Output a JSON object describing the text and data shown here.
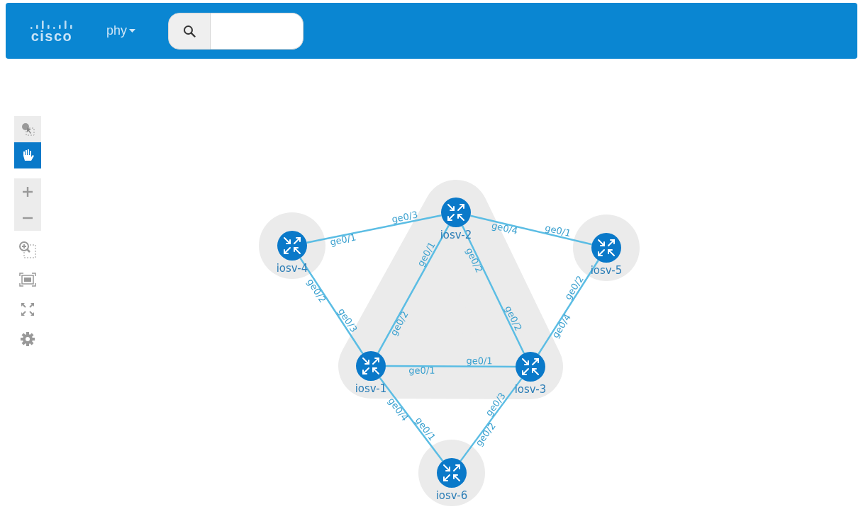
{
  "header": {
    "logo": "cisco",
    "view_menu": "phy"
  },
  "toolbar": {
    "mode_tools": [
      {
        "selected": false
      },
      {
        "selected": true
      }
    ]
  },
  "topology": {
    "nodes": [
      {
        "name": "iosv-2"
      },
      {
        "name": "iosv-4"
      },
      {
        "name": "iosv-5"
      },
      {
        "name": "iosv-1"
      },
      {
        "name": "iosv-3"
      },
      {
        "name": "iosv-6"
      }
    ],
    "links": [
      {
        "ends": [
          {
            "interface": "ge0/1"
          },
          {
            "interface": "ge0/3"
          }
        ]
      },
      {
        "ends": [
          {
            "interface": "ge0/4"
          },
          {
            "interface": "ge0/1"
          }
        ]
      },
      {
        "ends": [
          {
            "interface": "ge0/1"
          },
          {
            "interface": "ge0/2"
          }
        ]
      },
      {
        "ends": [
          {
            "interface": "ge0/2"
          },
          {
            "interface": "ge0/2"
          }
        ]
      },
      {
        "ends": [
          {
            "interface": "ge0/2"
          },
          {
            "interface": "ge0/3"
          }
        ]
      },
      {
        "ends": [
          {
            "interface": "ge0/2"
          },
          {
            "interface": "ge0/4"
          }
        ]
      },
      {
        "ends": [
          {
            "interface": "ge0/1"
          },
          {
            "interface": "ge0/1"
          }
        ]
      },
      {
        "ends": [
          {
            "interface": "ge0/4"
          },
          {
            "interface": "ge0/1"
          }
        ]
      },
      {
        "ends": [
          {
            "interface": "ge0/3"
          },
          {
            "interface": "ge0/2"
          }
        ]
      }
    ]
  }
}
